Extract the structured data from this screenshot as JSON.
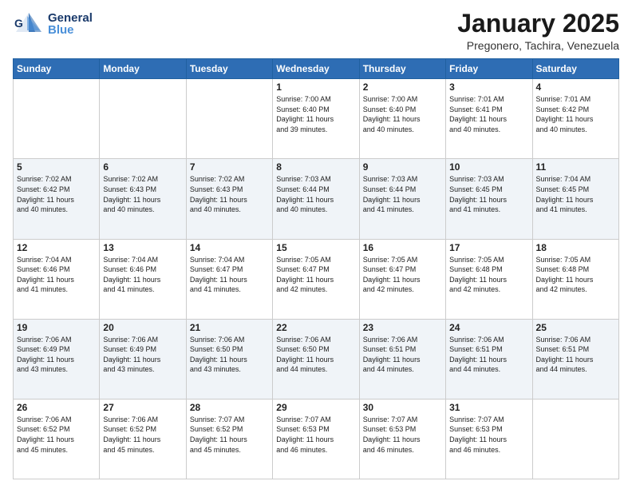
{
  "header": {
    "logo_general": "General",
    "logo_blue": "Blue",
    "month_title": "January 2025",
    "location": "Pregonero, Tachira, Venezuela"
  },
  "days_of_week": [
    "Sunday",
    "Monday",
    "Tuesday",
    "Wednesday",
    "Thursday",
    "Friday",
    "Saturday"
  ],
  "weeks": [
    [
      {
        "day": "",
        "info": ""
      },
      {
        "day": "",
        "info": ""
      },
      {
        "day": "",
        "info": ""
      },
      {
        "day": "1",
        "info": "Sunrise: 7:00 AM\nSunset: 6:40 PM\nDaylight: 11 hours\nand 39 minutes."
      },
      {
        "day": "2",
        "info": "Sunrise: 7:00 AM\nSunset: 6:40 PM\nDaylight: 11 hours\nand 40 minutes."
      },
      {
        "day": "3",
        "info": "Sunrise: 7:01 AM\nSunset: 6:41 PM\nDaylight: 11 hours\nand 40 minutes."
      },
      {
        "day": "4",
        "info": "Sunrise: 7:01 AM\nSunset: 6:42 PM\nDaylight: 11 hours\nand 40 minutes."
      }
    ],
    [
      {
        "day": "5",
        "info": "Sunrise: 7:02 AM\nSunset: 6:42 PM\nDaylight: 11 hours\nand 40 minutes."
      },
      {
        "day": "6",
        "info": "Sunrise: 7:02 AM\nSunset: 6:43 PM\nDaylight: 11 hours\nand 40 minutes."
      },
      {
        "day": "7",
        "info": "Sunrise: 7:02 AM\nSunset: 6:43 PM\nDaylight: 11 hours\nand 40 minutes."
      },
      {
        "day": "8",
        "info": "Sunrise: 7:03 AM\nSunset: 6:44 PM\nDaylight: 11 hours\nand 40 minutes."
      },
      {
        "day": "9",
        "info": "Sunrise: 7:03 AM\nSunset: 6:44 PM\nDaylight: 11 hours\nand 41 minutes."
      },
      {
        "day": "10",
        "info": "Sunrise: 7:03 AM\nSunset: 6:45 PM\nDaylight: 11 hours\nand 41 minutes."
      },
      {
        "day": "11",
        "info": "Sunrise: 7:04 AM\nSunset: 6:45 PM\nDaylight: 11 hours\nand 41 minutes."
      }
    ],
    [
      {
        "day": "12",
        "info": "Sunrise: 7:04 AM\nSunset: 6:46 PM\nDaylight: 11 hours\nand 41 minutes."
      },
      {
        "day": "13",
        "info": "Sunrise: 7:04 AM\nSunset: 6:46 PM\nDaylight: 11 hours\nand 41 minutes."
      },
      {
        "day": "14",
        "info": "Sunrise: 7:04 AM\nSunset: 6:47 PM\nDaylight: 11 hours\nand 41 minutes."
      },
      {
        "day": "15",
        "info": "Sunrise: 7:05 AM\nSunset: 6:47 PM\nDaylight: 11 hours\nand 42 minutes."
      },
      {
        "day": "16",
        "info": "Sunrise: 7:05 AM\nSunset: 6:47 PM\nDaylight: 11 hours\nand 42 minutes."
      },
      {
        "day": "17",
        "info": "Sunrise: 7:05 AM\nSunset: 6:48 PM\nDaylight: 11 hours\nand 42 minutes."
      },
      {
        "day": "18",
        "info": "Sunrise: 7:05 AM\nSunset: 6:48 PM\nDaylight: 11 hours\nand 42 minutes."
      }
    ],
    [
      {
        "day": "19",
        "info": "Sunrise: 7:06 AM\nSunset: 6:49 PM\nDaylight: 11 hours\nand 43 minutes."
      },
      {
        "day": "20",
        "info": "Sunrise: 7:06 AM\nSunset: 6:49 PM\nDaylight: 11 hours\nand 43 minutes."
      },
      {
        "day": "21",
        "info": "Sunrise: 7:06 AM\nSunset: 6:50 PM\nDaylight: 11 hours\nand 43 minutes."
      },
      {
        "day": "22",
        "info": "Sunrise: 7:06 AM\nSunset: 6:50 PM\nDaylight: 11 hours\nand 44 minutes."
      },
      {
        "day": "23",
        "info": "Sunrise: 7:06 AM\nSunset: 6:51 PM\nDaylight: 11 hours\nand 44 minutes."
      },
      {
        "day": "24",
        "info": "Sunrise: 7:06 AM\nSunset: 6:51 PM\nDaylight: 11 hours\nand 44 minutes."
      },
      {
        "day": "25",
        "info": "Sunrise: 7:06 AM\nSunset: 6:51 PM\nDaylight: 11 hours\nand 44 minutes."
      }
    ],
    [
      {
        "day": "26",
        "info": "Sunrise: 7:06 AM\nSunset: 6:52 PM\nDaylight: 11 hours\nand 45 minutes."
      },
      {
        "day": "27",
        "info": "Sunrise: 7:06 AM\nSunset: 6:52 PM\nDaylight: 11 hours\nand 45 minutes."
      },
      {
        "day": "28",
        "info": "Sunrise: 7:07 AM\nSunset: 6:52 PM\nDaylight: 11 hours\nand 45 minutes."
      },
      {
        "day": "29",
        "info": "Sunrise: 7:07 AM\nSunset: 6:53 PM\nDaylight: 11 hours\nand 46 minutes."
      },
      {
        "day": "30",
        "info": "Sunrise: 7:07 AM\nSunset: 6:53 PM\nDaylight: 11 hours\nand 46 minutes."
      },
      {
        "day": "31",
        "info": "Sunrise: 7:07 AM\nSunset: 6:53 PM\nDaylight: 11 hours\nand 46 minutes."
      },
      {
        "day": "",
        "info": ""
      }
    ]
  ]
}
